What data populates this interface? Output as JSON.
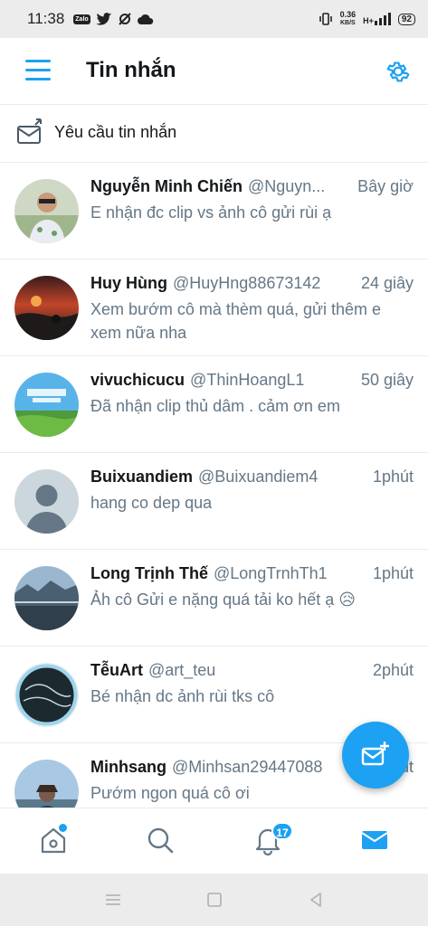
{
  "status_bar": {
    "time": "11:38",
    "zalo": "Zalo",
    "net_speed_value": "0.36",
    "net_speed_unit": "KB/S",
    "network": "H+",
    "battery": "92"
  },
  "header": {
    "title": "Tin nhắn"
  },
  "requests": {
    "label": "Yêu cầu tin nhắn"
  },
  "conversations": [
    {
      "name": "Nguyễn Minh Chiến",
      "handle": "@Nguyn...",
      "time": "Bây giờ",
      "message": "E nhận đc clip vs ảnh cô gửi rùi ạ"
    },
    {
      "name": "Huy Hùng",
      "handle": "@HuyHng88673142",
      "time": "24 giây",
      "message": "Xem bướm cô mà thèm quá, gửi thêm e xem nữa nha"
    },
    {
      "name": "vivuchicucu",
      "handle": "@ThinHoangL1",
      "time": "50 giây",
      "message": "Đã nhận clip thủ dâm . cảm ơn em"
    },
    {
      "name": "Buixuandiem",
      "handle": "@Buixuandiem4",
      "time": "1phút",
      "message": "hang co dep qua"
    },
    {
      "name": "Long Trịnh Thế",
      "handle": "@LongTrnhTh1",
      "time": "1phút",
      "message": "Ảh cô Gửi e nặng quá tải ko hết ạ 😥"
    },
    {
      "name": "TễuArt",
      "handle": "@art_teu",
      "time": "2phút",
      "message": "Bé nhận dc ảnh rùi tks cô"
    },
    {
      "name": "Minhsang",
      "handle": "@Minhsan29447088",
      "time": "2phút",
      "message": "Pướm ngon quá cô ơi"
    }
  ],
  "bottom_nav": {
    "notifications_badge": "17",
    "items": [
      "home-icon",
      "search-icon",
      "bell-icon",
      "mail-icon"
    ]
  },
  "colors": {
    "accent": "#1da1f2",
    "secondary_text": "#657786",
    "divider": "#e6ecf0"
  }
}
